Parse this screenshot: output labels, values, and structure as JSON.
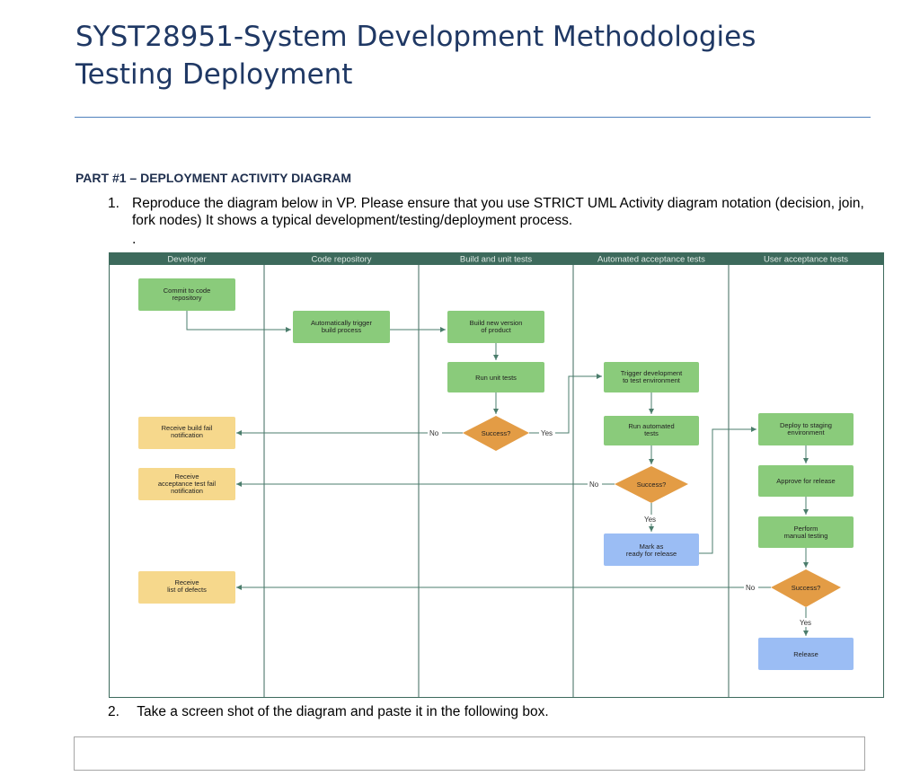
{
  "document": {
    "title_line1": "SYST28951-System Development Methodologies",
    "title_line2": "Testing Deployment",
    "part_heading": "PART #1 – DEPLOYMENT ACTIVITY DIAGRAM",
    "step1_number": "1.",
    "step1_text": "Reproduce the diagram below in VP. Please ensure that you use STRICT UML Activity diagram notation (decision, join, fork nodes) It shows a typical development/testing/deployment process.",
    "stray_dot": ".",
    "step2_number": "2.",
    "step2_text": "Take a screen shot of the diagram and paste it in the following box."
  },
  "diagram": {
    "lanes": [
      "Developer",
      "Code repository",
      "Build and unit tests",
      "Automated acceptance tests",
      "User acceptance tests"
    ],
    "nodes": {
      "commit": [
        "Commit to code",
        "repository"
      ],
      "trigger_build": [
        "Automatically trigger",
        "build process"
      ],
      "build_new": [
        "Build new version",
        "of product"
      ],
      "run_unit": [
        "Run unit tests"
      ],
      "success1": "Success?",
      "fail_build": [
        "Receive build fail",
        "notification"
      ],
      "trigger_dev": [
        "Trigger development",
        "to test environment"
      ],
      "run_auto": [
        "Run automated",
        "tests"
      ],
      "success2": "Success?",
      "fail_accept": [
        "Receive",
        "acceptance test fail",
        "notification"
      ],
      "mark_ready": [
        "Mark as",
        "ready for release"
      ],
      "deploy_staging": [
        "Deploy to staging",
        "environment"
      ],
      "approve": [
        "Approve for release"
      ],
      "manual_testing": [
        "Perform",
        "manual testing"
      ],
      "success3": "Success?",
      "defects": [
        "Receive",
        "list of defects"
      ],
      "release": [
        "Release"
      ]
    },
    "edge_labels": {
      "no": "No",
      "yes": "Yes"
    },
    "colors": {
      "header": "#3d6a5c",
      "header_text": "#dfe9e4",
      "lane_line": "#3d6a5c",
      "action_green": "#8acb7b",
      "notify_yellow": "#f6d88c",
      "decision_orange": "#e39c45",
      "final_blue": "#9bbdf4",
      "arrow": "#4b7d6c"
    }
  }
}
